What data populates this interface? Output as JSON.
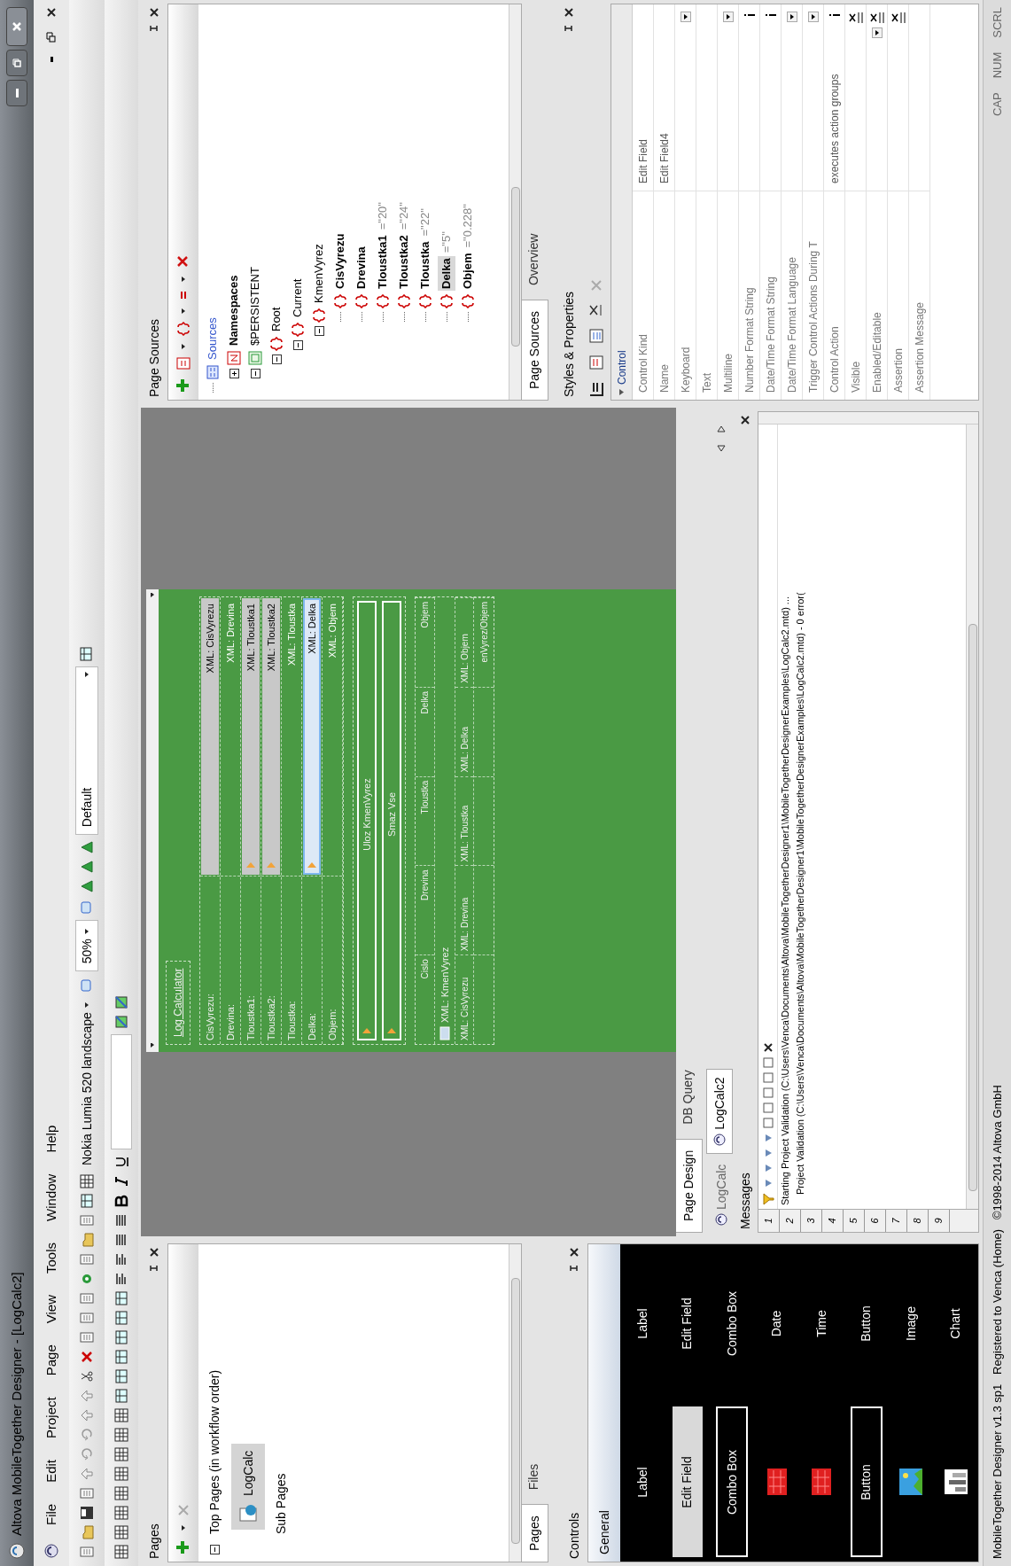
{
  "window": {
    "title": "Altova MobileTogether Designer - [LogCalc2]"
  },
  "menu": [
    "File",
    "Edit",
    "Project",
    "Page",
    "View",
    "Tools",
    "Window",
    "Help"
  ],
  "toolbar": {
    "device": "Nokia Lumia 520 landscape",
    "zoom": "50%",
    "style": "Default"
  },
  "pages_panel": {
    "title": "Pages",
    "tree": [
      {
        "label": "Top Pages (in workflow order)",
        "kind": "group",
        "expanded": true,
        "selected": false,
        "children": [
          {
            "label": "LogCalc",
            "kind": "page",
            "selected": true
          }
        ]
      },
      {
        "label": "Sub Pages",
        "kind": "group",
        "selected": false
      }
    ],
    "tabs": [
      {
        "label": "Pages",
        "selected": true
      },
      {
        "label": "Files",
        "selected": false
      }
    ]
  },
  "controls_panel": {
    "title": "Controls",
    "group": "General",
    "items": [
      {
        "kind": "label",
        "preview": "Label",
        "label": "Label"
      },
      {
        "kind": "edit",
        "preview": "Edit Field",
        "label": "Edit Field"
      },
      {
        "kind": "combo",
        "preview": "Combo Box",
        "label": "Combo Box"
      },
      {
        "kind": "date",
        "label": "Date"
      },
      {
        "kind": "time",
        "label": "Time"
      },
      {
        "kind": "button",
        "preview": "Button",
        "label": "Button"
      },
      {
        "kind": "image",
        "label": "Image"
      },
      {
        "kind": "chart",
        "label": "Chart"
      }
    ]
  },
  "design": {
    "title": "Log Calculator",
    "fields": [
      {
        "label": "CisVyrezu:",
        "value": "XML: CisVyrezu",
        "kind": "edit",
        "action": false,
        "selected": false
      },
      {
        "label": "Drevina:",
        "value": "XML: Drevina",
        "kind": "text",
        "action": false,
        "selected": false
      },
      {
        "label": "Tloustka1:",
        "value": "XML: Tloustka1",
        "kind": "edit",
        "action": true,
        "selected": false
      },
      {
        "label": "Tloustka2:",
        "value": "XML: Tloustka2",
        "kind": "edit",
        "action": true,
        "selected": false
      },
      {
        "label": "Tloustka:",
        "value": "XML: Tloustka",
        "kind": "text",
        "action": false,
        "selected": false
      },
      {
        "label": "Delka:",
        "value": "XML: Delka",
        "kind": "edit",
        "action": true,
        "selected": true
      },
      {
        "label": "Objem:",
        "value": "XML: Objem",
        "kind": "text",
        "action": false,
        "selected": false
      }
    ],
    "buttons": [
      "Uloz KmenVyrez",
      "Smaz Vse"
    ],
    "table": {
      "columns": [
        "Cislo",
        "Drevina",
        "Tloustka",
        "Delka",
        "Objem"
      ],
      "group": "XML: KmenVyrez",
      "row": [
        "XML: CisVyrezu",
        "XML: Drevina",
        "XML: Tloustka",
        "XML: Delka",
        "XML: Objem"
      ],
      "footer": "enVyrez/Objem"
    }
  },
  "editor_tabs": [
    {
      "label": "Page Design",
      "selected": true
    },
    {
      "label": "DB Query",
      "selected": false
    }
  ],
  "document_tabs": [
    {
      "label": "LogCalc",
      "selected": false
    },
    {
      "label": "LogCalc2",
      "selected": true
    }
  ],
  "messages": {
    "title": "Messages",
    "tabs": [
      "1",
      "2",
      "3",
      "4",
      "5",
      "6",
      "7",
      "8",
      "9"
    ],
    "lines": [
      "Starting Project Validation (C:\\Users\\Venca\\Documents\\Altova\\MobileTogetherDesigner1\\MobileTogetherDesignerExamples\\LogCalc2.mtd) ...",
      "Project Validation (C:\\Users\\Venca\\Documents\\Altova\\MobileTogetherDesigner1\\MobileTogetherDesignerExamples\\LogCalc2.mtd) - 0 error("
    ]
  },
  "page_sources": {
    "title": "Page Sources",
    "tree": [
      {
        "label": "Sources",
        "kind": "sources",
        "selected": false,
        "children": [
          {
            "label": "Namespaces",
            "kind": "namespace",
            "bold": true,
            "expanded": false,
            "selected": false
          },
          {
            "label": "$PERSISTENT",
            "kind": "persistent",
            "expanded": true,
            "selected": false,
            "children": [
              {
                "label": "Root",
                "kind": "element",
                "expanded": true,
                "selected": false,
                "children": [
                  {
                    "label": "Current",
                    "kind": "element",
                    "expanded": true,
                    "selected": false,
                    "children": [
                      {
                        "label": "KmenVyrez",
                        "kind": "element",
                        "expanded": true,
                        "selected": false,
                        "children": [
                          {
                            "label": "CisVyrezu",
                            "kind": "element",
                            "bold": true,
                            "selected": false
                          },
                          {
                            "label": "Drevina",
                            "kind": "element",
                            "bold": true,
                            "selected": false
                          },
                          {
                            "label": "Tloustka1",
                            "value": "=\"20\"",
                            "kind": "element",
                            "bold": true,
                            "selected": false
                          },
                          {
                            "label": "Tloustka2",
                            "value": "=\"24\"",
                            "kind": "element",
                            "bold": true,
                            "selected": false
                          },
                          {
                            "label": "Tloustka",
                            "value": "=\"22\"",
                            "kind": "element",
                            "bold": true,
                            "selected": false
                          },
                          {
                            "label": "Delka",
                            "value": "=\"5\"",
                            "kind": "element",
                            "bold": true,
                            "selected": true
                          },
                          {
                            "label": "Objem",
                            "value": "=\"0.228\"",
                            "kind": "element",
                            "bold": true,
                            "selected": false
                          }
                        ]
                      }
                    ]
                  }
                ]
              }
            ]
          }
        ]
      }
    ],
    "tabs": [
      {
        "label": "Page Sources",
        "selected": true
      },
      {
        "label": "Overview",
        "selected": false
      }
    ]
  },
  "properties": {
    "title": "Styles & Properties",
    "section": "Control",
    "expanded": true,
    "rows": [
      {
        "name": "Control Kind",
        "value": "Edit Field",
        "kind": "text"
      },
      {
        "name": "Name",
        "value": "Edit Field4",
        "kind": "text"
      },
      {
        "name": "Keyboard",
        "kind": "dropdown"
      },
      {
        "name": "Text",
        "kind": "text"
      },
      {
        "name": "Multiline",
        "kind": "dropdown"
      },
      {
        "name": "Number Format String",
        "kind": "info"
      },
      {
        "name": "Date/Time Format String",
        "kind": "info"
      },
      {
        "name": "Date/Time Format Language",
        "kind": "dropdown"
      },
      {
        "name": "Trigger Control Actions During T",
        "kind": "dropdown"
      },
      {
        "name": "Control Action",
        "value": "executes action groups",
        "kind": "info"
      },
      {
        "name": "Visible",
        "kind": "xpath"
      },
      {
        "name": "Enabled/Editable",
        "kind": "dropdown_xpath"
      },
      {
        "name": "Assertion",
        "kind": "xpath"
      },
      {
        "name": "Assertion Message",
        "kind": "text"
      }
    ]
  },
  "status_bar": {
    "text": "MobileTogether Designer v1.3 sp1   Registered to Venca (Home)   ©1998-2014 Altova GmbH",
    "indicators": [
      "CAP",
      "NUM",
      "SCRL"
    ]
  }
}
